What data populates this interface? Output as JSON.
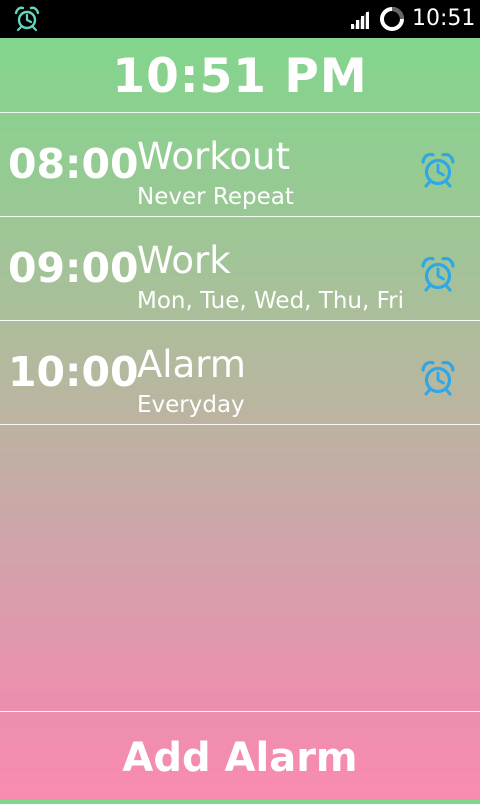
{
  "status_bar": {
    "time": "10:51",
    "icons": [
      "alarm-icon",
      "signal-icon",
      "sync-icon"
    ]
  },
  "header": {
    "clock": "10:51 PM"
  },
  "alarms": [
    {
      "time": "08:00",
      "name": "Workout",
      "repeat": "Never Repeat",
      "icon": "alarm-clock-icon"
    },
    {
      "time": "09:00",
      "name": "Work",
      "repeat": "Mon, Tue, Wed, Thu, Fri",
      "icon": "alarm-clock-icon"
    },
    {
      "time": "10:00",
      "name": "Alarm",
      "repeat": "Everyday",
      "icon": "alarm-clock-icon"
    }
  ],
  "footer": {
    "add_label": "Add Alarm"
  },
  "colors": {
    "status_bar": "#000000",
    "gradient_top": "#7dd88b",
    "gradient_bottom": "#f98bb1",
    "alarm_icon": "#2fa7e6",
    "text": "#ffffff"
  }
}
